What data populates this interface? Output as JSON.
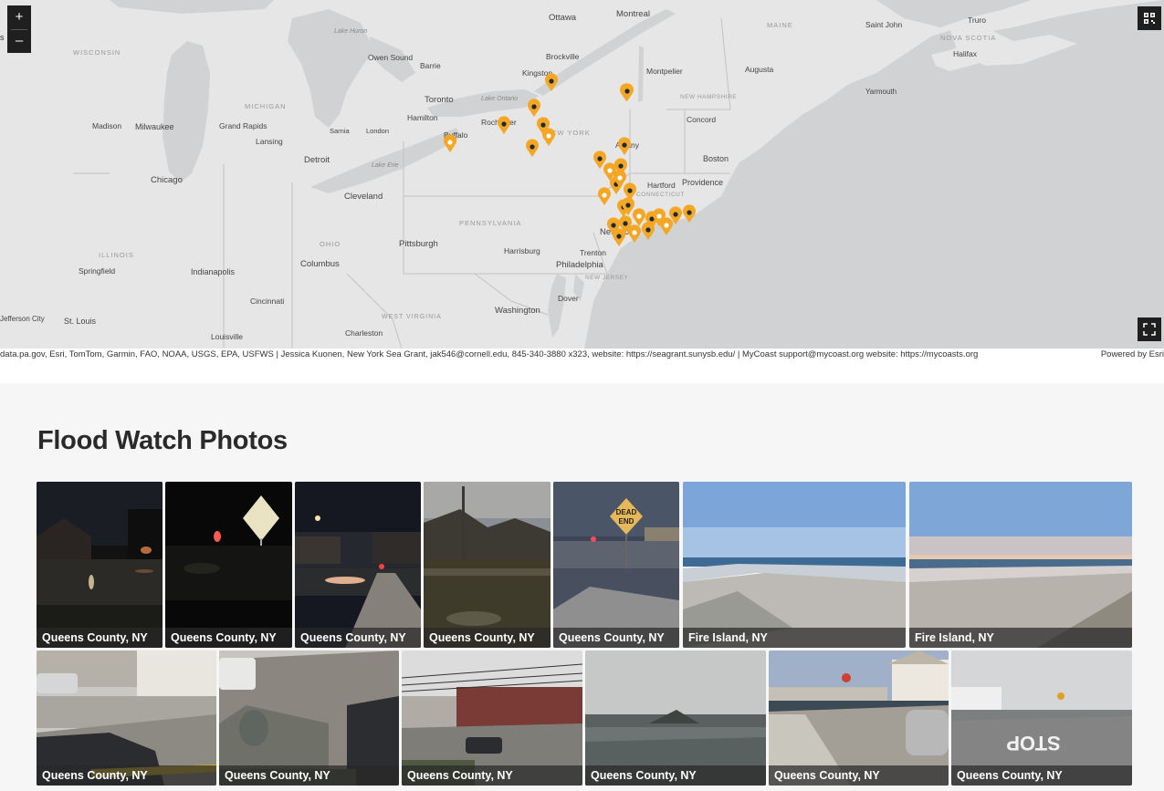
{
  "map": {
    "zoom_in": "+",
    "zoom_out": "–",
    "qr_icon": "qr-code-icon",
    "fullscreen_icon": "fullscreen-icon",
    "cut_label": "s",
    "labels": {
      "ottawa": "Ottawa",
      "montreal": "Montreal",
      "brockville": "Brockville",
      "barrie": "Barrie",
      "owen_sound": "Owen Sound",
      "kingston": "Kingston",
      "montpelier": "Montpelier",
      "augusta": "Augusta",
      "saint_john": "Saint John",
      "truro": "Truro",
      "halifax": "Halifax",
      "maine": "MAINE",
      "nova_scotia": "NOVA SCOTIA",
      "yarmouth": "Yarmouth",
      "wisconsin": "WISCONSIN",
      "lake_huron": "Lake Huron",
      "michigan": "MICHIGAN",
      "toronto": "Toronto",
      "lake_ontario": "Lake Ontario",
      "hamilton": "Hamilton",
      "rochester": "Rochester",
      "new_york_state": "NEW YORK",
      "new_hampshire": "NEW HAMPSHIRE",
      "concord": "Concord",
      "madison": "Madison",
      "milwaukee": "Milwaukee",
      "grand_rapids": "Grand Rapids",
      "sarnia": "Sarnia",
      "london": "London",
      "buffalo": "Buffalo",
      "lansing": "Lansing",
      "albany": "Albany",
      "boston": "Boston",
      "detroit": "Detroit",
      "lake_erie": "Lake Erie",
      "hartford": "Hartford",
      "connecticut": "CONNECTICUT",
      "providence": "Providence",
      "chicago": "Chicago",
      "cleveland": "Cleveland",
      "pennsylvania": "PENNSYLVANIA",
      "new_york_city": "New York",
      "illinois": "ILLINOIS",
      "ohio": "OHIO",
      "pittsburgh": "Pittsburgh",
      "springfield": "Springfield",
      "indianapolis": "Indianapolis",
      "columbus": "Columbus",
      "harrisburg": "Harrisburg",
      "trenton": "Trenton",
      "philadelphia": "Philadelphia",
      "new_jersey": "NEW JERSEY",
      "cincinnati": "Cincinnati",
      "dover": "Dover",
      "west_virginia": "WEST VIRGINIA",
      "washington": "Washington",
      "jefferson_city": "Jefferson City",
      "st_louis": "St. Louis",
      "louisville": "Louisville",
      "charleston": "Charleston"
    },
    "attribution": "data.pa.gov, Esri, TomTom, Garmin, FAO, NOAA, USGS, EPA, USFWS | Jessica Kuonen, New York Sea Grant, jak546@cornell.edu, 845-340-3880 x323, website: https://seagrant.sunysb.edu/ | MyCoast support@mycoast.org website: https://mycoasts.org",
    "powered_by": "Powered by Esri",
    "accent": "#f5a623"
  },
  "gallery": {
    "title": "Flood Watch Photos",
    "row1": [
      {
        "caption": "Queens County, NY"
      },
      {
        "caption": "Queens County, NY"
      },
      {
        "caption": "Queens County, NY"
      },
      {
        "caption": "Queens County, NY"
      },
      {
        "caption": "Queens County, NY"
      },
      {
        "caption": "Fire Island, NY"
      },
      {
        "caption": "Fire Island, NY"
      }
    ],
    "row2": [
      {
        "caption": "Queens County, NY"
      },
      {
        "caption": "Queens County, NY"
      },
      {
        "caption": "Queens County, NY"
      },
      {
        "caption": "Queens County, NY"
      },
      {
        "caption": "Queens County, NY"
      },
      {
        "caption": "Queens County, NY"
      }
    ],
    "stop_marking": "STOP",
    "dead_end_sign": "DEAD END"
  }
}
